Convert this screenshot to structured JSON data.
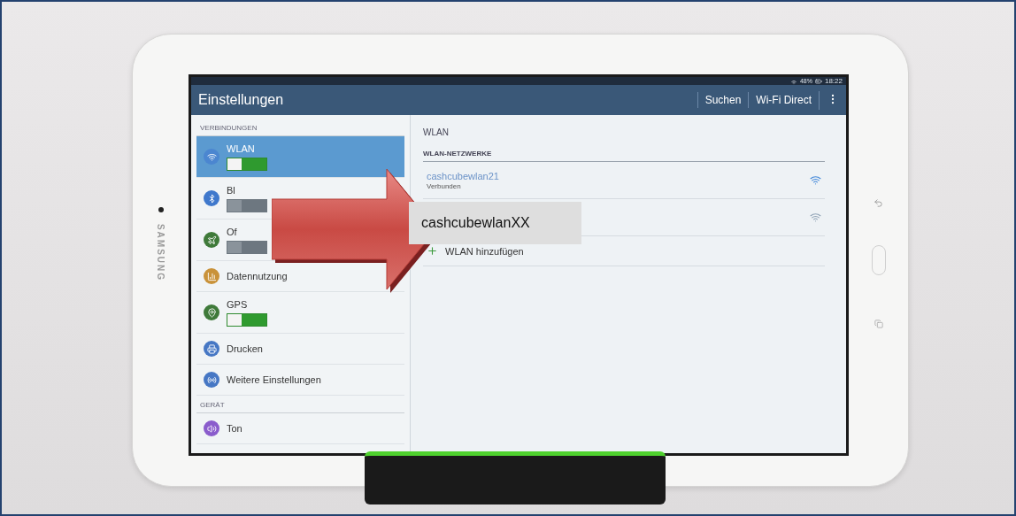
{
  "device": {
    "brand": "SAMSUNG"
  },
  "status_bar": {
    "battery": "48%",
    "time": "18:22"
  },
  "action_bar": {
    "title": "Einstellungen",
    "actions": [
      "Suchen",
      "Wi-Fi Direct"
    ]
  },
  "sidebar": {
    "sections": [
      {
        "heading": "VERBINDUNGEN",
        "items": [
          {
            "label": "WLAN",
            "kind": "toggle",
            "on": true,
            "selected": true,
            "color": "#4b86d0"
          },
          {
            "label": "Bl",
            "kind": "toggle",
            "on": false,
            "selected": false,
            "color": "#3f78cc"
          },
          {
            "label": "Of",
            "kind": "toggle",
            "on": false,
            "selected": false,
            "color": "#3f7a3a"
          },
          {
            "label": "Datennutzung",
            "kind": "plain",
            "selected": false,
            "color": "#c9923a"
          },
          {
            "label": "GPS",
            "kind": "toggle",
            "on": true,
            "selected": false,
            "color": "#3f7a3a"
          },
          {
            "label": "Drucken",
            "kind": "plain",
            "selected": false,
            "color": "#4677c4"
          },
          {
            "label": "Weitere Einstellungen",
            "kind": "plain",
            "selected": false,
            "color": "#4677c4"
          }
        ]
      },
      {
        "heading": "GERÄT",
        "items": [
          {
            "label": "Ton",
            "kind": "plain",
            "selected": false,
            "color": "#8a5ccc"
          }
        ]
      }
    ]
  },
  "content": {
    "title": "WLAN",
    "section": "WLAN-NETZWERKE",
    "networks": [
      {
        "name": "cashcubewlan21",
        "status": "Verbunden",
        "connected": true
      },
      {
        "connected": false
      }
    ],
    "add_label": "WLAN hinzufügen"
  },
  "annotation": {
    "callout": "cashcubewlanXX"
  }
}
